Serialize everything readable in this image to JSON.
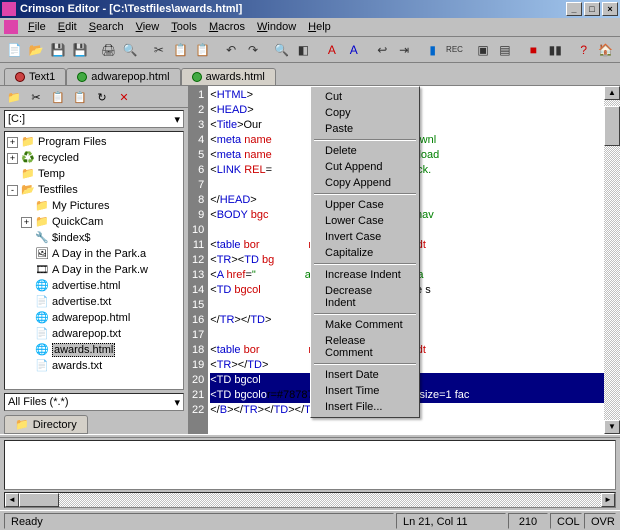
{
  "title": "Crimson Editor - [C:\\Testfiles\\awards.html]",
  "menus": [
    "File",
    "Edit",
    "Search",
    "View",
    "Tools",
    "Macros",
    "Window",
    "Help"
  ],
  "tabs": [
    {
      "label": "Text1",
      "dot": "red"
    },
    {
      "label": "adwarepop.html",
      "dot": "green"
    },
    {
      "label": "awards.html",
      "dot": "green",
      "active": true
    }
  ],
  "drive": "[C:]",
  "tree": [
    {
      "depth": 0,
      "pm": "+",
      "icon": "📁",
      "label": "Program Files"
    },
    {
      "depth": 0,
      "pm": "+",
      "icon": "♻️",
      "label": "recycled"
    },
    {
      "depth": 0,
      "pm": "",
      "icon": "📁",
      "label": "Temp"
    },
    {
      "depth": 0,
      "pm": "-",
      "icon": "📂",
      "label": "Testfiles"
    },
    {
      "depth": 1,
      "pm": "",
      "icon": "📁",
      "label": "My Pictures"
    },
    {
      "depth": 1,
      "pm": "+",
      "icon": "📁",
      "label": "QuickCam"
    },
    {
      "depth": 1,
      "pm": "",
      "icon": "🔧",
      "label": "$index$"
    },
    {
      "depth": 1,
      "pm": "",
      "icon": "🖼",
      "label": "A Day in the Park.a"
    },
    {
      "depth": 1,
      "pm": "",
      "icon": "🎞",
      "label": "A Day in the Park.w"
    },
    {
      "depth": 1,
      "pm": "",
      "icon": "🌐",
      "label": "advertise.html"
    },
    {
      "depth": 1,
      "pm": "",
      "icon": "📄",
      "label": "advertise.txt"
    },
    {
      "depth": 1,
      "pm": "",
      "icon": "🌐",
      "label": "adwarepop.html"
    },
    {
      "depth": 1,
      "pm": "",
      "icon": "📄",
      "label": "adwarepop.txt"
    },
    {
      "depth": 1,
      "pm": "",
      "icon": "🌐",
      "label": "awards.html",
      "selected": true
    },
    {
      "depth": 1,
      "pm": "",
      "icon": "📄",
      "label": "awards.txt"
    }
  ],
  "filter": "All Files (*.*)",
  "side_tab": "Directory",
  "code_lines": [
    {
      "html": "&lt;<span class='b'>HTML</span>&gt;"
    },
    {
      "html": "&lt;<span class='b'>HEAD</span>&gt;"
    },
    {
      "html": "&lt;<span class='b'>Title</span>&gt;<span class='k'>Our</span>                <span class='k'>ck-Internet Tool Provi</span>"
    },
    {
      "html": "&lt;<span class='b'>meta</span> <span class='r'>name</span>                <span class='r'>ontent</span>=<span class='g'>\"freeware downl</span>"
    },
    {
      "html": "&lt;<span class='b'>meta</span> <span class='r'>name</span>                <span class='r'>ent</span>=<span class='g'>\"freeware download</span>"
    },
    {
      "html": "&lt;<span class='b'>LINK</span> <span class='r'>REL</span>=                <span class='g'>\"http://www.webattack.</span>"
    },
    {
      "html": ""
    },
    {
      "html": "&lt;/<span class='b'>HEAD</span>&gt;"
    },
    {
      "html": "&lt;<span class='b'>BODY</span> <span class='r'>bgc</span>                 <span class='r'>xt</span>=<span class='g'>\"#000000\"</span> <span class='r'>link</span>=<span class='g'>\"nav</span>"
    },
    {
      "html": ""
    },
    {
      "html": "&lt;<span class='b'>table</span> <span class='r'>bor</span>                <span class='r'>ng</span>=<span class='num'>0</span> <span class='r'>cellspacing</span>=<span class='num'>0</span> <span class='r'>widt</span>"
    },
    {
      "html": "&lt;<span class='b'>TR</span>&gt;&lt;<span class='b'>TD</span> <span class='r'>bg</span>"
    },
    {
      "html": "&lt;<span class='b'>A</span> <span class='r'>href</span>=<span class='g'>\"</span>                <span class='g'>ack.com/\"</span>&gt;&lt;<span class='b'>IMG</span> <span class='r'>src</span>=<span class='g'>\"/a</span>"
    },
    {
      "html": "&lt;<span class='b'>TD</span> <span class='r'>bgcol</span>                <span class='k'>re downloads</span>&lt;<span class='b'>BR</span>&gt;<span class='k'>free s</span>"
    },
    {
      "html": ""
    },
    {
      "html": "&lt;/<span class='b'>TR</span>&gt;&lt;/<span class='b'>TD</span>&gt;"
    },
    {
      "html": ""
    },
    {
      "html": "&lt;<span class='b'>table</span> <span class='r'>bor</span>                <span class='r'>ng</span>=<span class='num'>0</span> <span class='r'>cellspacing</span>=<span class='num'>0</span> <span class='r'>widt</span>"
    },
    {
      "html": "&lt;<span class='b'>TR</span>&gt;&lt;/<span class='b'>TD</span>&gt;"
    },
    {
      "sel": true,
      "html": "&lt;TD bgcol                 class=default size=2 f"
    },
    {
      "sel": true,
      "html": "&lt;TD <span class='k' style='color:#fff'>bgcolo</span><span class='k'>r=#787878 </span><span class='r'>align</span>=<span class='k'>right&gt;&lt;</span>FONT <span class='r'>size</span>=<span class='num'>1</span> <span class='r'>fac</span>"
    },
    {
      "html": "&lt;/<span class='b'>B</span>&gt;&lt;/<span class='b'>TR</span>&gt;&lt;/<span class='b'>TD</span>&gt;&lt;/<span class='b'>TABLE</span>&gt;"
    }
  ],
  "context_menu": [
    "Cut",
    "Copy",
    "Paste",
    "-",
    "Delete",
    "Cut Append",
    "Copy Append",
    "-",
    "Upper Case",
    "Lower Case",
    "Invert Case",
    "Capitalize",
    "-",
    "Increase Indent",
    "Decrease Indent",
    "-",
    "Make Comment",
    "Release Comment",
    "-",
    "Insert Date",
    "Insert Time",
    "Insert File..."
  ],
  "status": {
    "ready": "Ready",
    "pos": "Ln 21, Col 11",
    "num": "210",
    "col": "COL",
    "ovr": "OVR"
  }
}
